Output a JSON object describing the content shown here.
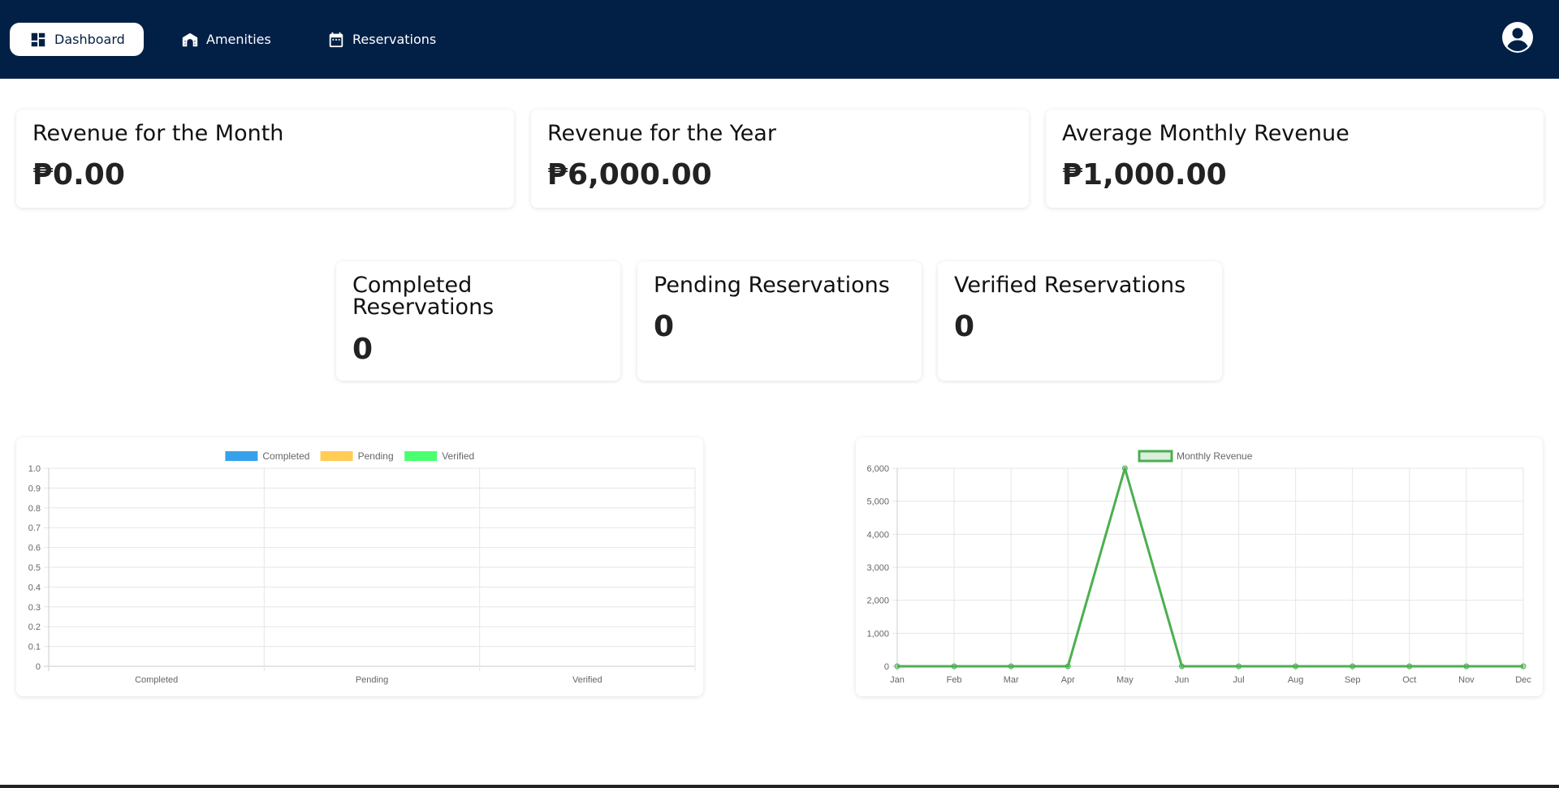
{
  "nav": {
    "items": [
      {
        "label": "Dashboard",
        "icon": "dashboard-icon",
        "active": true
      },
      {
        "label": "Amenities",
        "icon": "amenities-icon",
        "active": false
      },
      {
        "label": "Reservations",
        "icon": "calendar-icon",
        "active": false
      }
    ],
    "avatar_icon": "account-circle-icon"
  },
  "revenue": {
    "month": {
      "title": "Revenue for the Month",
      "value": "₱0.00"
    },
    "year": {
      "title": "Revenue for the Year",
      "value": "₱6,000.00"
    },
    "average": {
      "title": "Average Monthly Revenue",
      "value": "₱1,000.00"
    }
  },
  "reservations": {
    "completed": {
      "title_line1": "Completed",
      "title_line2": "Reservations",
      "value": "0"
    },
    "pending": {
      "title": "Pending Reservations",
      "value": "0"
    },
    "verified": {
      "title": "Verified Reservations",
      "value": "0"
    }
  },
  "colors": {
    "navbar": "#022046",
    "completed": "#36a2eb",
    "pending": "#ffcd56",
    "verified": "#4bff6e",
    "revenue_line": "#4caf50"
  },
  "chart_data": [
    {
      "type": "bar",
      "categories": [
        "Completed",
        "Pending",
        "Verified"
      ],
      "series": [
        {
          "name": "Completed",
          "values": [
            0,
            0,
            0
          ]
        },
        {
          "name": "Pending",
          "values": [
            0,
            0,
            0
          ]
        },
        {
          "name": "Verified",
          "values": [
            0,
            0,
            0
          ]
        }
      ],
      "yticks": [
        "1.0",
        "0.9",
        "0.8",
        "0.7",
        "0.6",
        "0.5",
        "0.4",
        "0.3",
        "0.2",
        "0.1",
        "0"
      ],
      "ylim": [
        0,
        1
      ],
      "grid": true,
      "legend": "top-center"
    },
    {
      "type": "line",
      "categories": [
        "Jan",
        "Feb",
        "Mar",
        "Apr",
        "May",
        "Jun",
        "Jul",
        "Aug",
        "Sep",
        "Oct",
        "Nov",
        "Dec"
      ],
      "series": [
        {
          "name": "Monthly Revenue",
          "values": [
            0,
            0,
            0,
            0,
            6000,
            0,
            0,
            0,
            0,
            0,
            0,
            0
          ]
        }
      ],
      "yticks": [
        "6,000",
        "5,000",
        "4,000",
        "3,000",
        "2,000",
        "1,000",
        "0"
      ],
      "ylim": [
        0,
        6000
      ],
      "grid": true,
      "legend": "top-center"
    }
  ]
}
